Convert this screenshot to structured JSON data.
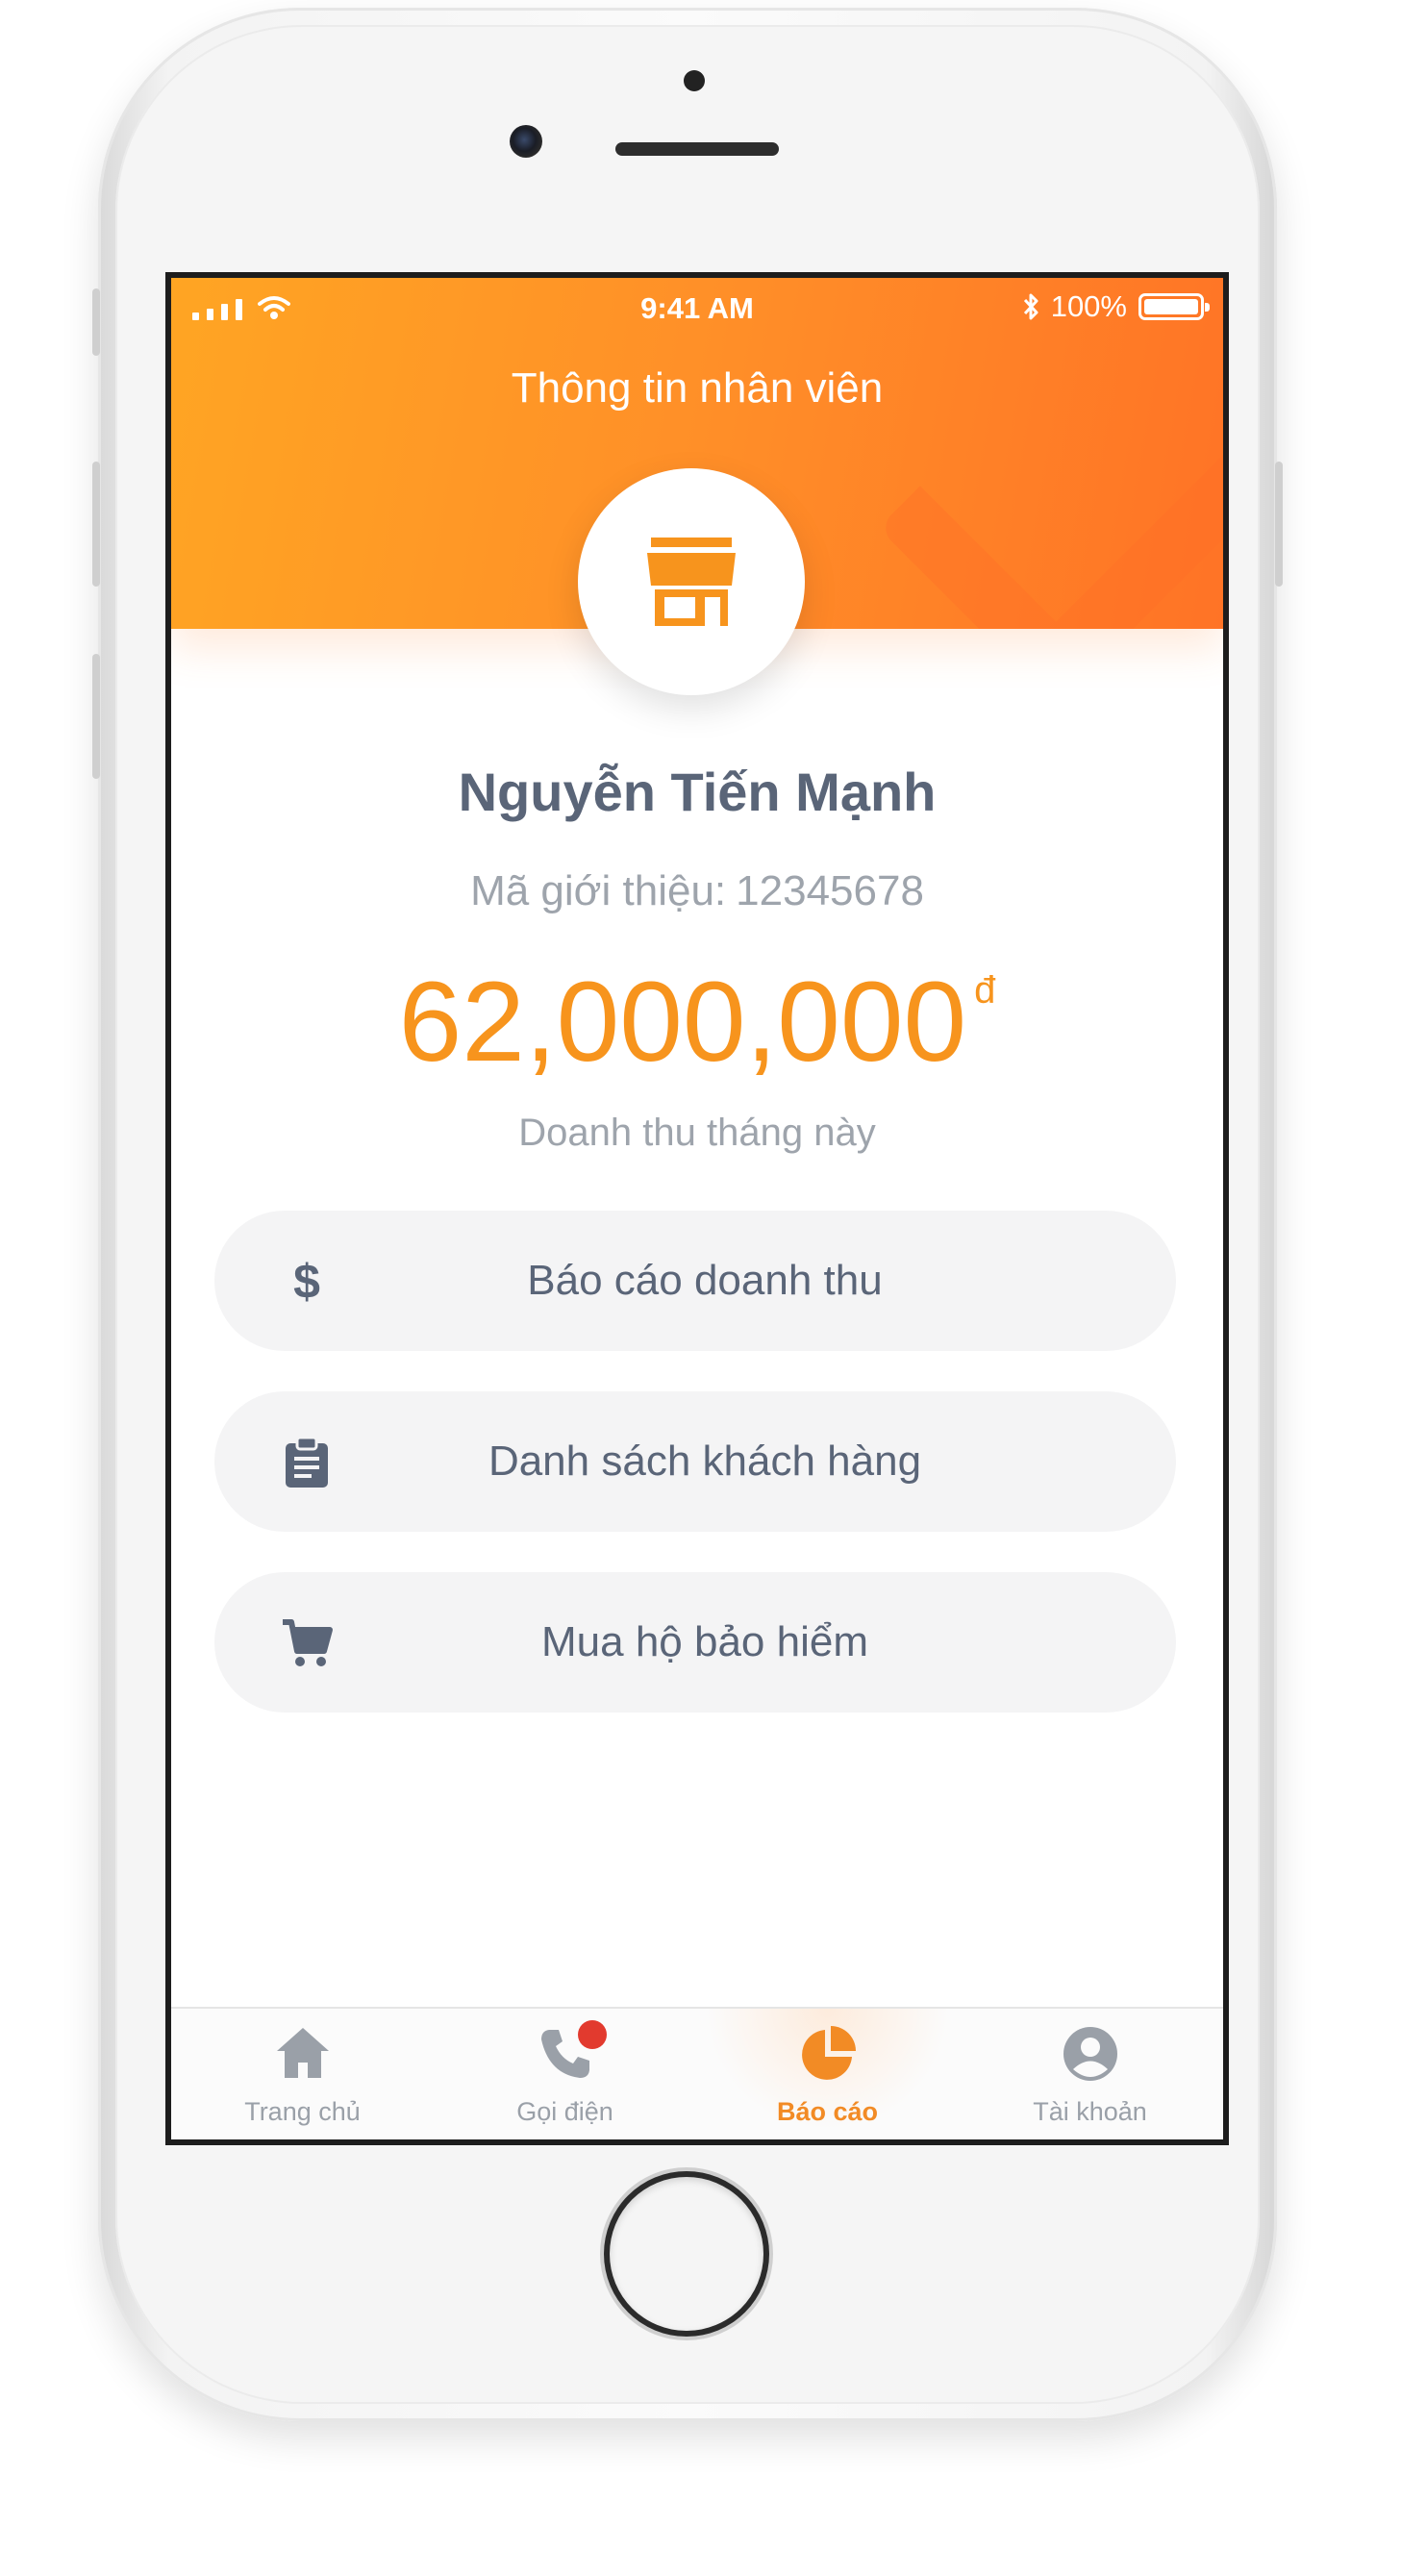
{
  "status_bar": {
    "time": "9:41 AM",
    "battery_text": "100%"
  },
  "header": {
    "title": "Thông tin nhân viên",
    "avatar_icon": "store-icon"
  },
  "profile": {
    "name": "Nguyễn Tiến Mạnh",
    "referral_label": "Mã giới thiệu:",
    "referral_code": "12345678",
    "revenue_value": "62,000,000",
    "revenue_currency": "đ",
    "revenue_caption": "Doanh thu tháng này"
  },
  "menu": [
    {
      "label": "Báo cáo doanh thu",
      "icon": "dollar-icon"
    },
    {
      "label": "Danh sách khách hàng",
      "icon": "clipboard-icon"
    },
    {
      "label": "Mua hộ bảo hiểm",
      "icon": "cart-icon"
    }
  ],
  "tabs": [
    {
      "label": "Trang chủ",
      "icon": "home-icon",
      "active": false
    },
    {
      "label": "Gọi điện",
      "icon": "phone-icon",
      "active": false,
      "notification": true
    },
    {
      "label": "Báo cáo",
      "icon": "pie-chart-icon",
      "active": true
    },
    {
      "label": "Tài khoản",
      "icon": "account-icon",
      "active": false
    }
  ],
  "colors": {
    "accent": "#f7941d",
    "header_start": "#ffa523",
    "header_end": "#ff7326",
    "text_primary": "#5a6578",
    "text_muted": "#9ea4ac",
    "badge": "#e23a2e"
  }
}
